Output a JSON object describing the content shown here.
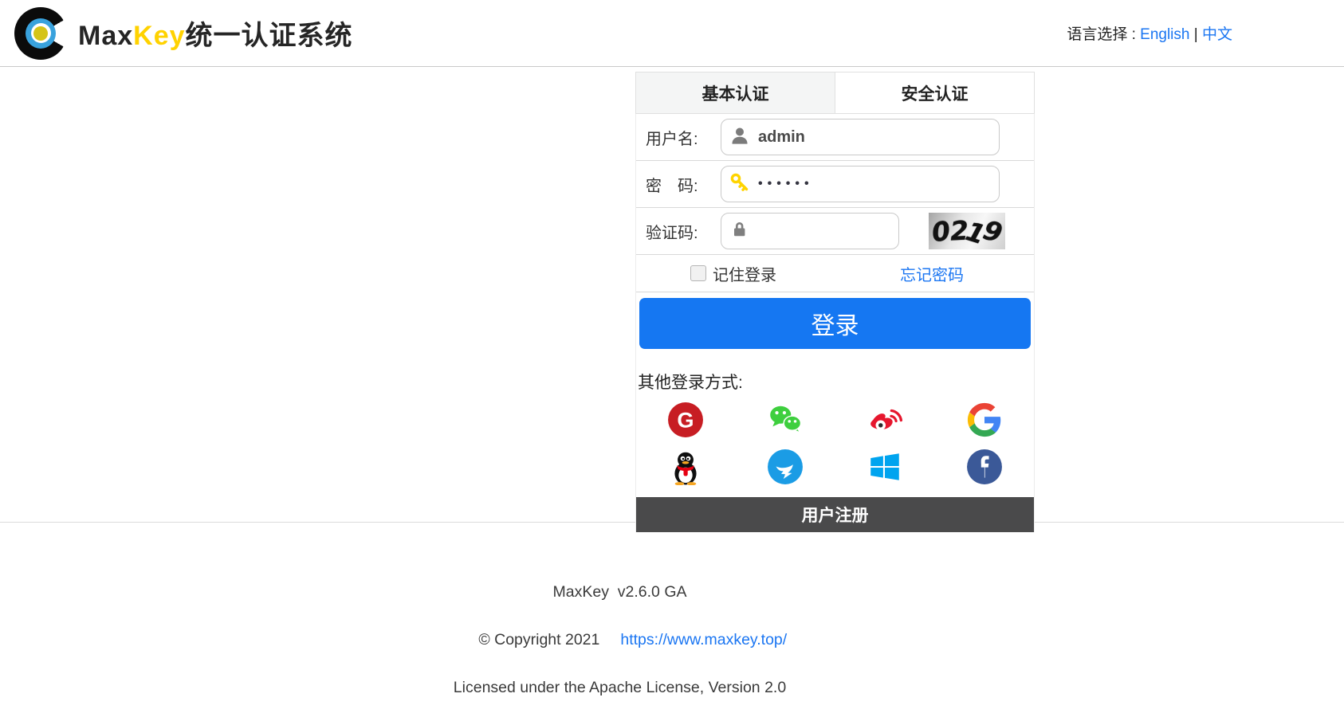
{
  "header": {
    "brand_max": "Max",
    "brand_key": "Key",
    "brand_suffix": "统一认证系统",
    "language_label": "语言选择 :",
    "language_english": "English",
    "language_divider": "|",
    "language_chinese": "中文"
  },
  "login": {
    "tab_basic": "基本认证",
    "tab_secure": "安全认证",
    "username_label": "用户名:",
    "username_value": "admin",
    "password_label": "密　码:",
    "password_value": "••••••",
    "captcha_label": "验证码:",
    "captcha_value": "",
    "captcha_image_text": "0219",
    "remember_label": "记住登录",
    "forgot_label": "忘记密码",
    "submit_label": "登录",
    "other_methods_label": "其他登录方式:",
    "social_providers": [
      {
        "name": "gitee"
      },
      {
        "name": "wechat"
      },
      {
        "name": "weibo"
      },
      {
        "name": "google"
      },
      {
        "name": "qq"
      },
      {
        "name": "dingtalk"
      },
      {
        "name": "microsoft"
      },
      {
        "name": "facebook"
      }
    ],
    "register_label": "用户注册"
  },
  "footer": {
    "version": "MaxKey  v2.6.0 GA",
    "copyright": "© Copyright 2021",
    "site_link": "https://www.maxkey.top/",
    "license": "Licensed under the Apache License, Version 2.0"
  },
  "colors": {
    "accent_blue": "#1577f2",
    "link_blue": "#1b76f2",
    "brand_yellow": "#ffd200",
    "register_bar": "#4a4a4b"
  }
}
